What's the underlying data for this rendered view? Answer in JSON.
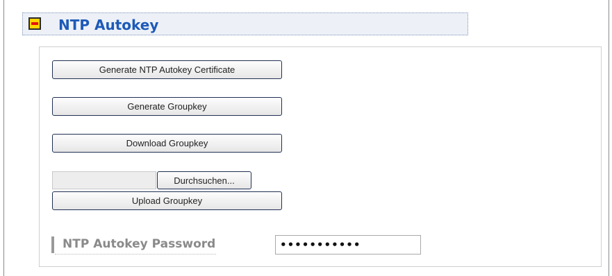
{
  "section": {
    "title": "NTP Autokey",
    "toggle_icon": "collapse-minus-icon"
  },
  "buttons": {
    "generate_certificate": "Generate NTP Autokey Certificate",
    "generate_groupkey": "Generate Groupkey",
    "download_groupkey": "Download Groupkey",
    "browse": "Durchsuchen...",
    "upload_groupkey": "Upload Groupkey"
  },
  "file_input": {
    "value": ""
  },
  "password": {
    "label": "NTP Autokey Password",
    "masked_value": "•••••••••••"
  },
  "colors": {
    "title": "#1d5ab8",
    "header_bg": "#edf1f7",
    "toggle_fill": "#ffd400",
    "toggle_bar": "#e3120b",
    "button_border": "#1f2f52"
  }
}
